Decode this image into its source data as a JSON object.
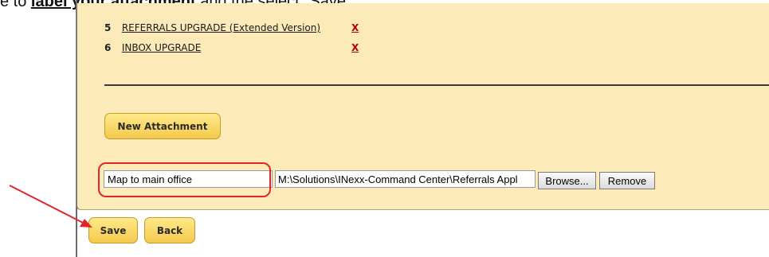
{
  "caption": {
    "prefix": "e to ",
    "underlined": "label your attachment",
    "suffix": " and the select \"Save\"."
  },
  "attachments": [
    {
      "number": "5",
      "title": "REFERRALS UPGRADE (Extended Version)",
      "delete_label": "X"
    },
    {
      "number": "6",
      "title": "INBOX UPGRADE",
      "delete_label": "X"
    }
  ],
  "new_attachment_button": "New Attachment",
  "label_input": {
    "value": "Map to main office"
  },
  "file_path": {
    "value": "M:\\Solutions\\INexx-Command Center\\Referrals Appl"
  },
  "browse_button": "Browse...",
  "remove_button": "Remove",
  "save_button": "Save",
  "back_button": "Back",
  "colors": {
    "panel": "#fcebb8",
    "button": "#f4c94c",
    "highlight": "#e0262a",
    "delete": "#b30000"
  }
}
